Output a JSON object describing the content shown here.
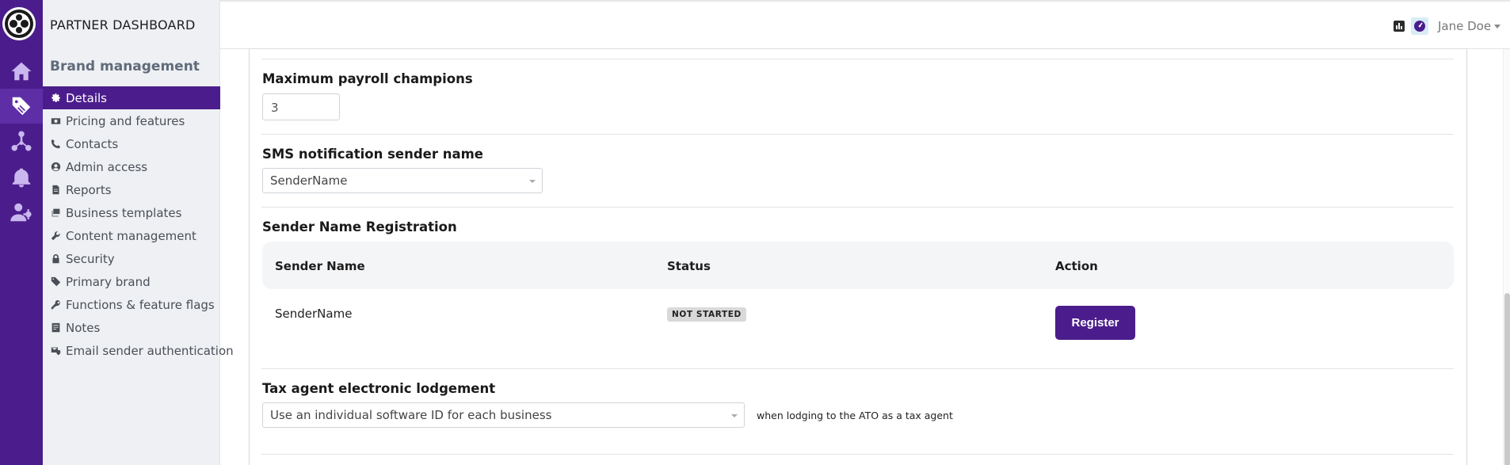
{
  "app": {
    "title": "PARTNER DASHBOARD"
  },
  "rail": {
    "items": [
      "home-icon",
      "tag-icon",
      "org-chart-icon",
      "bell-icon",
      "user-settings-icon"
    ],
    "active": "tag-icon"
  },
  "sidebar": {
    "section_title": "Brand management",
    "items": [
      {
        "label": "Details",
        "icon": "gear-icon",
        "active": true
      },
      {
        "label": "Pricing and features",
        "icon": "money-icon"
      },
      {
        "label": "Contacts",
        "icon": "phone-icon"
      },
      {
        "label": "Admin access",
        "icon": "user-circle-icon"
      },
      {
        "label": "Reports",
        "icon": "document-icon"
      },
      {
        "label": "Business templates",
        "icon": "layers-icon"
      },
      {
        "label": "Content management",
        "icon": "wrench-icon"
      },
      {
        "label": "Security",
        "icon": "lock-icon"
      },
      {
        "label": "Primary brand",
        "icon": "tag-icon"
      },
      {
        "label": "Functions & feature flags",
        "icon": "key-icon"
      },
      {
        "label": "Notes",
        "icon": "note-icon"
      },
      {
        "label": "Email sender authentication",
        "icon": "mail-shield-icon"
      }
    ]
  },
  "topbar": {
    "user_name": "Jane Doe",
    "icons": [
      "chart-icon",
      "speed-icon"
    ]
  },
  "form": {
    "max_payroll": {
      "label": "Maximum payroll champions",
      "value": "3"
    },
    "sms_sender": {
      "label": "SMS notification sender name",
      "value": "SenderName"
    },
    "registration": {
      "label": "Sender Name Registration",
      "columns": [
        "Sender Name",
        "Status",
        "Action"
      ],
      "rows": [
        {
          "sender_name": "SenderName",
          "status": "NOT STARTED",
          "action": "Register"
        }
      ]
    },
    "tax_agent": {
      "label": "Tax agent electronic lodgement",
      "value": "Use an individual software ID for each business",
      "hint": "when lodging to the ATO as a tax agent"
    }
  },
  "colors": {
    "brand": "#4b1d8c",
    "sidebar_bg": "#eef0f3",
    "badge_bg": "#d9d9d9"
  }
}
